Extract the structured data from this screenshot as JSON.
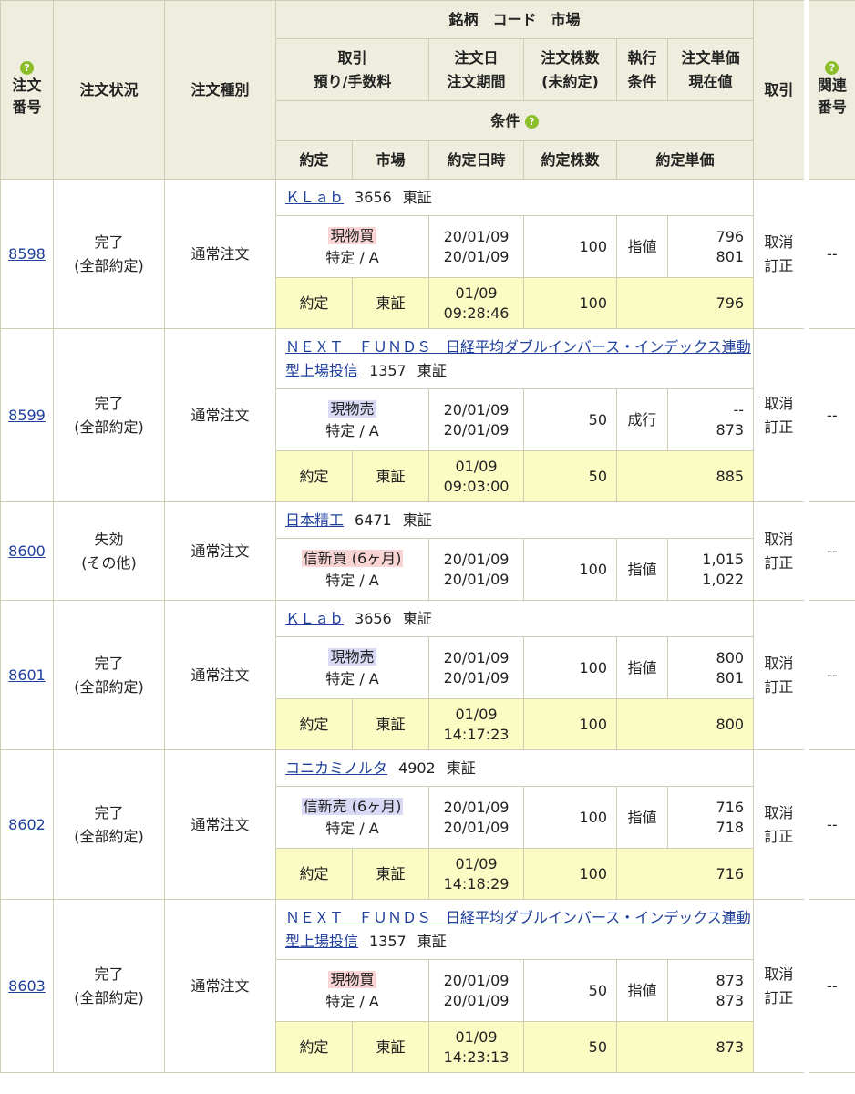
{
  "headers": {
    "order_no": "注文\n番号",
    "status": "注文状況",
    "type": "注文種別",
    "stock_code_market": "銘柄　コード　市場",
    "trade_fee": "取引\n預り/手数料",
    "order_date_period": "注文日\n注文期間",
    "qty_unfilled": "注文株数\n(未約定)",
    "exec_cond": "執行\n条件",
    "price_current": "注文単価\n現在値",
    "action": "取引",
    "related": "関連\n番号",
    "condition": "条件",
    "fill": "約定",
    "market": "市場",
    "fill_datetime": "約定日時",
    "fill_qty": "約定株数",
    "fill_price": "約定単価"
  },
  "help_icon": "help-icon",
  "orders": [
    {
      "order_no": "8598",
      "status": "完了\n(全部約定)",
      "order_type": "通常注文",
      "stock_name": "ＫＬａｂ",
      "code": "3656",
      "market": "東証",
      "trade": "現物買",
      "trade_kind": "buy",
      "account": "特定 / A",
      "order_date": "20/01/09",
      "period": "20/01/09",
      "qty": "100",
      "exec": "指値",
      "price": "796",
      "current": "801",
      "actions": [
        "取消",
        "訂正"
      ],
      "related": "--",
      "fill": {
        "label": "約定",
        "market": "東証",
        "date": "01/09",
        "time": "09:28:46",
        "qty": "100",
        "price": "796"
      }
    },
    {
      "order_no": "8599",
      "status": "完了\n(全部約定)",
      "order_type": "通常注文",
      "stock_name": "ＮＥＸＴ　ＦＵＮＤＳ　日経平均ダブルインバース・インデックス連動型上場投信",
      "code": "1357",
      "market": "東証",
      "trade": "現物売",
      "trade_kind": "sell",
      "account": "特定 / A",
      "order_date": "20/01/09",
      "period": "20/01/09",
      "qty": "50",
      "exec": "成行",
      "price": "--",
      "current": "873",
      "actions": [
        "取消",
        "訂正"
      ],
      "related": "--",
      "fill": {
        "label": "約定",
        "market": "東証",
        "date": "01/09",
        "time": "09:03:00",
        "qty": "50",
        "price": "885"
      }
    },
    {
      "order_no": "8600",
      "status": "失効\n(その他)",
      "order_type": "通常注文",
      "stock_name": "日本精工",
      "code": "6471",
      "market": "東証",
      "trade": "信新買 (6ヶ月)",
      "trade_kind": "buy",
      "account": "特定 / A",
      "order_date": "20/01/09",
      "period": "20/01/09",
      "qty": "100",
      "exec": "指値",
      "price": "1,015",
      "current": "1,022",
      "actions": [
        "取消",
        "訂正"
      ],
      "related": "--",
      "fill": null
    },
    {
      "order_no": "8601",
      "status": "完了\n(全部約定)",
      "order_type": "通常注文",
      "stock_name": "ＫＬａｂ",
      "code": "3656",
      "market": "東証",
      "trade": "現物売",
      "trade_kind": "sell",
      "account": "特定 / A",
      "order_date": "20/01/09",
      "period": "20/01/09",
      "qty": "100",
      "exec": "指値",
      "price": "800",
      "current": "801",
      "actions": [
        "取消",
        "訂正"
      ],
      "related": "--",
      "fill": {
        "label": "約定",
        "market": "東証",
        "date": "01/09",
        "time": "14:17:23",
        "qty": "100",
        "price": "800"
      }
    },
    {
      "order_no": "8602",
      "status": "完了\n(全部約定)",
      "order_type": "通常注文",
      "stock_name": "コニカミノルタ",
      "code": "4902",
      "market": "東証",
      "trade": "信新売 (6ヶ月)",
      "trade_kind": "sell",
      "account": "特定 / A",
      "order_date": "20/01/09",
      "period": "20/01/09",
      "qty": "100",
      "exec": "指値",
      "price": "716",
      "current": "718",
      "actions": [
        "取消",
        "訂正"
      ],
      "related": "--",
      "fill": {
        "label": "約定",
        "market": "東証",
        "date": "01/09",
        "time": "14:18:29",
        "qty": "100",
        "price": "716"
      }
    },
    {
      "order_no": "8603",
      "status": "完了\n(全部約定)",
      "order_type": "通常注文",
      "stock_name": "ＮＥＸＴ　ＦＵＮＤＳ　日経平均ダブルインバース・インデックス連動型上場投信",
      "code": "1357",
      "market": "東証",
      "trade": "現物買",
      "trade_kind": "buy",
      "account": "特定 / A",
      "order_date": "20/01/09",
      "period": "20/01/09",
      "qty": "50",
      "exec": "指値",
      "price": "873",
      "current": "873",
      "actions": [
        "取消",
        "訂正"
      ],
      "related": "--",
      "fill": {
        "label": "約定",
        "market": "東証",
        "date": "01/09",
        "time": "14:23:13",
        "qty": "50",
        "price": "873"
      }
    }
  ]
}
